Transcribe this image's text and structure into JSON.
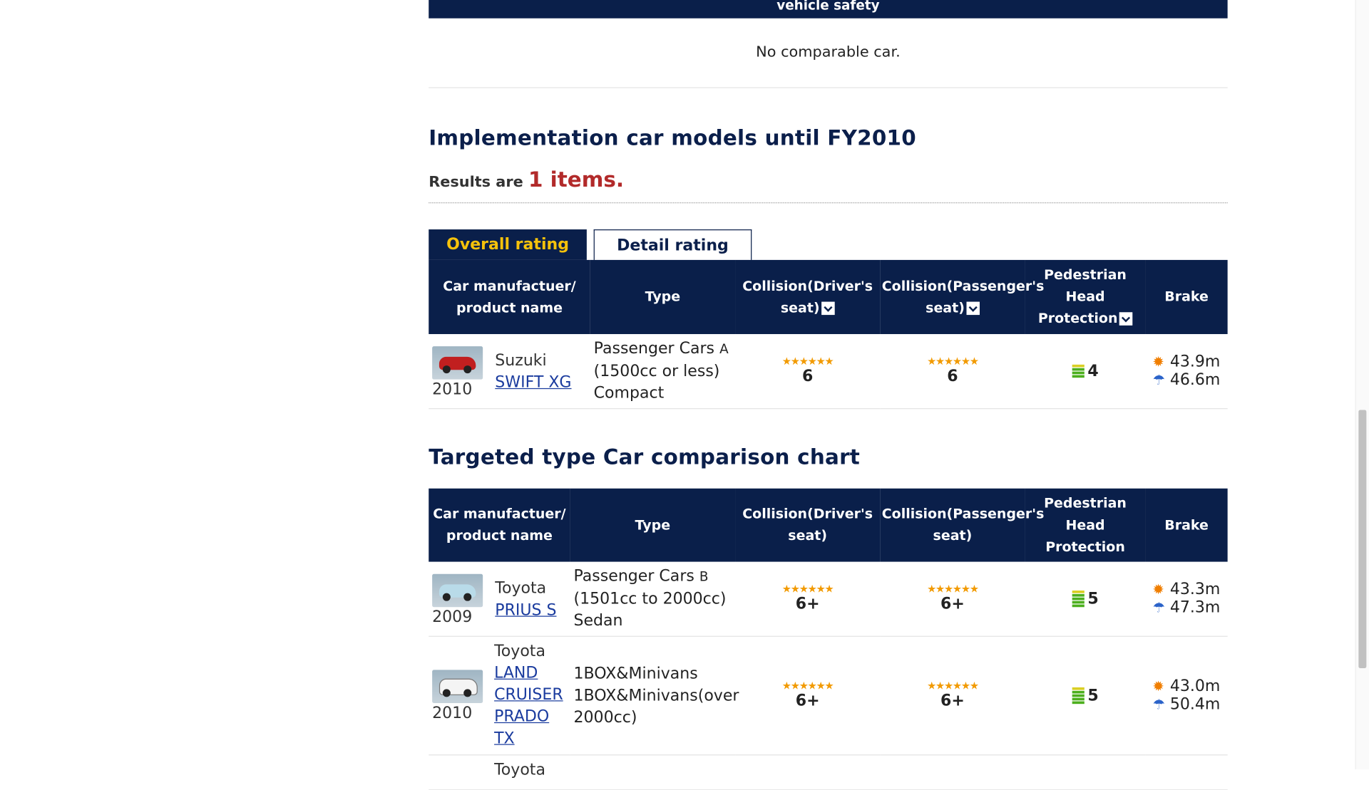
{
  "prev_section": {
    "header_label": "vehicle safety",
    "empty_message": "No comparable car."
  },
  "implementation": {
    "title": "Implementation car models until FY2010",
    "results_prefix": "Results are",
    "results_count": "1 items.",
    "tabs": [
      {
        "label": "Overall rating",
        "active": true
      },
      {
        "label": "Detail rating",
        "active": false
      }
    ],
    "columns": {
      "car_l1": "Car manufactuer/",
      "car_l2": "product name",
      "type": "Type",
      "driver_l1": "Collision(Driver's",
      "driver_l2": "seat)",
      "passenger_l1": "Collision(Passenger's",
      "passenger_l2": "seat)",
      "ped_l1": "Pedestrian",
      "ped_l2": "Head",
      "ped_l3": "Protection",
      "brake": "Brake"
    },
    "rows": [
      {
        "year": "2010",
        "maker": "Suzuki",
        "model": "SWIFT XG",
        "type_l1": "Passenger Cars",
        "class": "A",
        "type_l2": "(1500cc or less)",
        "type_l3": "Compact",
        "driver_stars": "★★★★★★",
        "driver": "6",
        "passenger_stars": "★★★★★★",
        "passenger": "6",
        "pedestrian": "4",
        "brake_dry": "43.9m",
        "brake_wet": "46.6m"
      }
    ]
  },
  "comparison": {
    "title": "Targeted type Car comparison chart",
    "columns": {
      "car_l1": "Car manufactuer/",
      "car_l2": "product name",
      "type": "Type",
      "driver_l1": "Collision(Driver's",
      "driver_l2": "seat)",
      "passenger_l1": "Collision(Passenger's",
      "passenger_l2": "seat)",
      "ped_l1": "Pedestrian",
      "ped_l2": "Head",
      "ped_l3": "Protection",
      "brake": "Brake"
    },
    "rows": [
      {
        "year": "2009",
        "maker": "Toyota",
        "model": "PRIUS S",
        "type_l1": "Passenger Cars",
        "class": "B",
        "type_l2": "(1501cc to 2000cc)",
        "type_l3": "Sedan",
        "driver_stars": "★★★★★★",
        "driver": "6+",
        "passenger_stars": "★★★★★★",
        "passenger": "6+",
        "pedestrian": "5",
        "brake_dry": "43.3m",
        "brake_wet": "47.3m"
      },
      {
        "year": "2010",
        "maker": "Toyota",
        "model_l1": "LAND",
        "model_l2": "CRUISER",
        "model_l3": "PRADO",
        "model_l4": "TX",
        "type_l1": "1BOX&Minivans",
        "type_l2": "1BOX&Minivans(over",
        "type_l3": "2000cc)",
        "driver_stars": "★★★★★★",
        "driver": "6+",
        "passenger_stars": "★★★★★★",
        "passenger": "6+",
        "pedestrian": "5",
        "brake_dry": "43.0m",
        "brake_wet": "50.4m"
      },
      {
        "maker": "Toyota"
      }
    ]
  },
  "colors": {
    "navy": "#0a1f4a",
    "tab_gold": "#f6c20b",
    "count_red": "#b22a2a",
    "link": "#1a3b9e"
  },
  "icons": {
    "dropdown": "chevron-down-icon",
    "dry": "sun-icon",
    "wet": "umbrella-icon",
    "pedestrian": "bar-gauge-icon"
  }
}
